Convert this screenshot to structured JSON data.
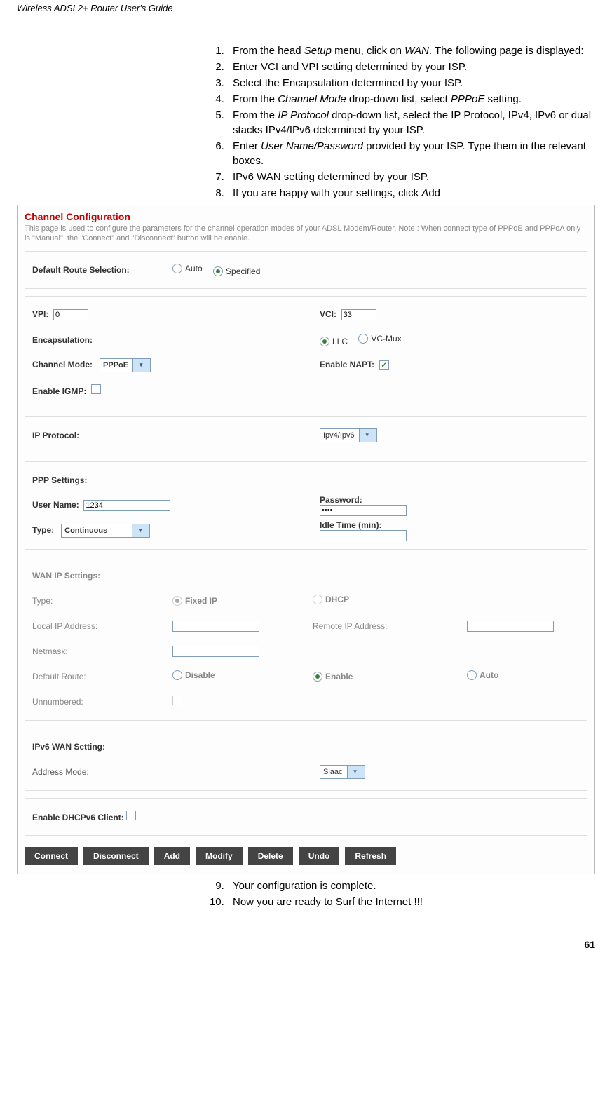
{
  "header": "Wireless ADSL2+ Router User's Guide",
  "page_number": "61",
  "steps_top": [
    {
      "num": "1.",
      "prefix": "From the head ",
      "em1": "Setup",
      "mid": " menu, click on ",
      "em2": "WAN",
      "suffix": ". The following page is displayed:"
    },
    {
      "num": "2.",
      "text": "Enter VCI and VPI setting determined by your ISP."
    },
    {
      "num": "3.",
      "text": "Select the Encapsulation determined by your ISP."
    },
    {
      "num": "4.",
      "prefix": "From the ",
      "em1": "Channel Mode",
      "mid": " drop-down list, select ",
      "em2": "PPPoE",
      "suffix": " setting."
    },
    {
      "num": "5.",
      "prefix": "From the ",
      "em1": "IP Protocol",
      "suffix": " drop-down list, select the IP Protocol, IPv4, IPv6 or dual stacks IPv4/IPv6 determined by your ISP."
    },
    {
      "num": "6.",
      "prefix": "Enter ",
      "em1": "User Name/Password",
      "suffix": " provided by your ISP. Type them in the relevant boxes."
    },
    {
      "num": "7.",
      "text": "IPv6 WAN setting determined by your ISP."
    },
    {
      "num": "8.",
      "prefix": "If you are happy with your settings, click ",
      "em1": "A",
      "suffix2": "dd"
    }
  ],
  "steps_bottom": [
    {
      "num": "9.",
      "text": "Your configuration is complete."
    },
    {
      "num": "10.",
      "text": "Now you are ready to Surf the Internet !!!"
    }
  ],
  "panel": {
    "title": "Channel Configuration",
    "note": "This page is used to configure the parameters for the channel operation modes of your ADSL Modem/Router. Note : When connect type of PPPoE and PPPoA only is \"Manual\", the \"Connect\" and \"Disconnect\" button will be enable.",
    "default_route_label": "Default Route Selection:",
    "default_route_opts": {
      "auto": "Auto",
      "specified": "Specified"
    },
    "vpi_label": "VPI:",
    "vpi_value": "0",
    "vci_label": "VCI:",
    "vci_value": "33",
    "encap_label": "Encapsulation:",
    "encap_opts": {
      "llc": "LLC",
      "vcmux": "VC-Mux"
    },
    "channel_mode_label": "Channel Mode:",
    "channel_mode_value": "PPPoE",
    "enable_napt_label": "Enable NAPT:",
    "enable_igmp_label": "Enable IGMP:",
    "ip_protocol_label": "IP Protocol:",
    "ip_protocol_value": "Ipv4/Ipv6",
    "ppp_settings_label": "PPP Settings:",
    "username_label": "User Name:",
    "username_value": "1234",
    "password_label": "Password:",
    "password_value": "••••",
    "type_label": "Type:",
    "type_value": "Continuous",
    "idle_label": "Idle Time (min):",
    "wan_ip_label": "WAN IP Settings:",
    "wan_type_label": "Type:",
    "wan_type_opts": {
      "fixed": "Fixed IP",
      "dhcp": "DHCP"
    },
    "local_ip_label": "Local IP Address:",
    "remote_ip_label": "Remote IP Address:",
    "netmask_label": "Netmask:",
    "def_route_label": "Default Route:",
    "def_route_opts": {
      "disable": "Disable",
      "enable": "Enable",
      "auto": "Auto"
    },
    "unnumbered_label": "Unnumbered:",
    "ipv6_wan_label": "IPv6 WAN Setting:",
    "address_mode_label": "Address Mode:",
    "address_mode_value": "Slaac",
    "dhcpv6_label": "Enable DHCPv6 Client:",
    "buttons": [
      "Connect",
      "Disconnect",
      "Add",
      "Modify",
      "Delete",
      "Undo",
      "Refresh"
    ]
  }
}
